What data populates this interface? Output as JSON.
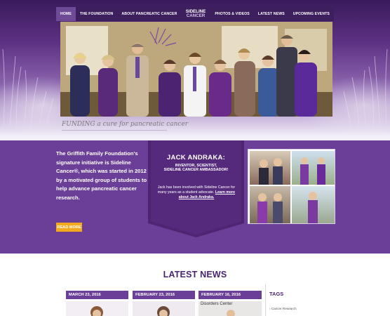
{
  "nav": {
    "items": [
      {
        "label": "HOME",
        "active": true
      },
      {
        "label": "THE FOUNDATION",
        "active": false
      },
      {
        "label": "ABOUT PANCREATIC CANCER",
        "active": false
      },
      {
        "label": "PHOTOS & VIDEOS",
        "active": false
      },
      {
        "label": "LATEST NEWS",
        "active": false
      },
      {
        "label": "UPCOMING EVENTS",
        "active": false
      }
    ]
  },
  "logo": {
    "line1": "SIDELINE",
    "line2": "CANCER"
  },
  "hero": {
    "tagline": "FUNDING a cure for pancreatic cancer"
  },
  "intro": {
    "text": "The Griffith Family Foundation's signature initiative is Sideline Cancer®, which was started in 2012 by a motivated group of students to help advance pancreatic cancer research.",
    "button": "READ MORE"
  },
  "jack": {
    "title": "JACK ANDRAKA:",
    "subtitle_line1": "INVENTOR, SCIENTIST,",
    "subtitle_line2": "SIDELINE CANCER AMBASSADOR!",
    "body": "Jack has been involved with Sideline Cancer for many years as a student advocate.",
    "link": "Learn more about Jack Andraka."
  },
  "news": {
    "title": "LATEST NEWS",
    "dates": [
      "MARCH 23, 2016",
      "FEBRUARY 23, 2016",
      "FEBRUARY 16, 2016"
    ],
    "thumb3_text": "Disorders Center"
  },
  "tags": {
    "title": "TAGS",
    "items": [
      "Cancer Research"
    ]
  },
  "colors": {
    "primary_purple": "#6b3f97",
    "nav_dark": "#3d1f5e",
    "accent_orange": "#f2a91e"
  }
}
